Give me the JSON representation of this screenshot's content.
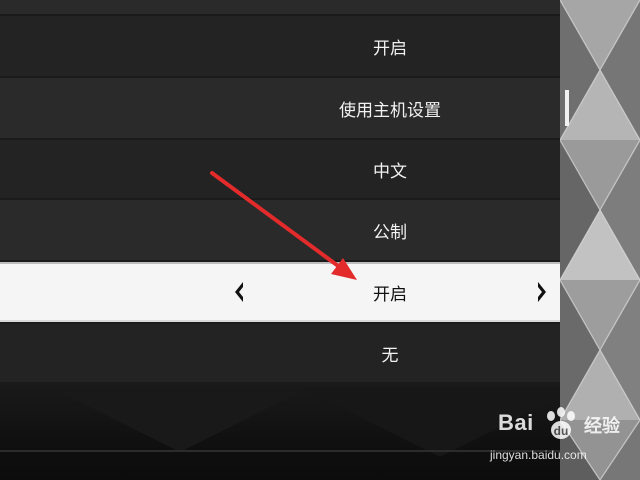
{
  "menu": {
    "rows": [
      {
        "value": "开启"
      },
      {
        "value": "使用主机设置"
      },
      {
        "value": "中文"
      },
      {
        "value": "公制"
      },
      {
        "value": "开启",
        "selected": true
      },
      {
        "value": "无"
      }
    ]
  },
  "icons": {
    "left_arrow": "chevron-left-icon",
    "right_arrow": "chevron-right-icon"
  },
  "colors": {
    "selected_row_bg": "#f5f5f5",
    "annotation_arrow": "#e32b2b"
  },
  "watermark": {
    "brand": "Bai",
    "brand_suffix": "经验",
    "url": "jingyan.baidu.com"
  }
}
